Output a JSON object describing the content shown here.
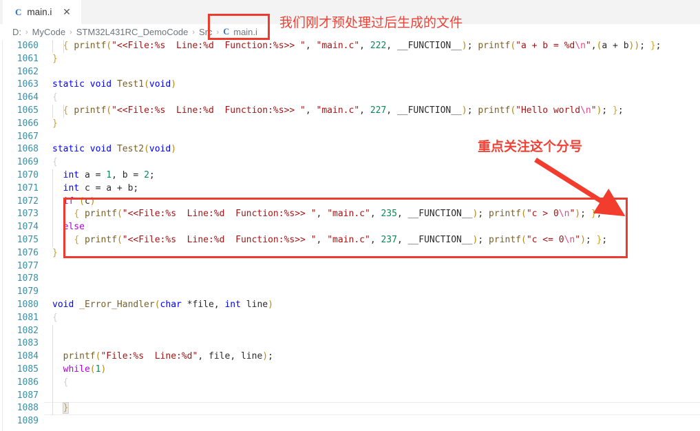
{
  "tab": {
    "file_icon": "C",
    "label": "main.i",
    "close_icon": "✕"
  },
  "breadcrumb": {
    "separator": "›",
    "items": [
      "D:",
      "MyCode",
      "STM32L431RC_DemoCode",
      "Src"
    ],
    "file_icon": "C",
    "file": "main.i"
  },
  "annotations": {
    "top_note": "我们刚才预处理过后生成的文件",
    "code_note": "重点关注这个分号",
    "color": "#ef3b2d"
  },
  "editor": {
    "first_line_number": 1060,
    "lines": [
      {
        "n": 1060,
        "indent": 2,
        "guides": [
          0,
          1
        ],
        "code": "  { printf(\"<<File:%s  Line:%d  Function:%s>> \", \"main.c\", 222, __FUNCTION__); printf(\"a + b = %d\\n\",(a + b)); };"
      },
      {
        "n": 1061,
        "indent": 0,
        "guides": [],
        "code": "}"
      },
      {
        "n": 1062,
        "indent": 0,
        "guides": [],
        "code": ""
      },
      {
        "n": 1063,
        "indent": 0,
        "guides": [],
        "code": "static void Test1(void)"
      },
      {
        "n": 1064,
        "indent": 0,
        "guides": [],
        "code": "{"
      },
      {
        "n": 1065,
        "indent": 2,
        "guides": [
          0,
          1
        ],
        "code": "  { printf(\"<<File:%s  Line:%d  Function:%s>> \", \"main.c\", 227, __FUNCTION__); printf(\"Hello world\\n\"); };"
      },
      {
        "n": 1066,
        "indent": 0,
        "guides": [],
        "code": "}"
      },
      {
        "n": 1067,
        "indent": 0,
        "guides": [],
        "code": ""
      },
      {
        "n": 1068,
        "indent": 0,
        "guides": [],
        "code": "static void Test2(void)"
      },
      {
        "n": 1069,
        "indent": 0,
        "guides": [],
        "code": "{"
      },
      {
        "n": 1070,
        "indent": 1,
        "guides": [
          0
        ],
        "code": "  int a = 1, b = 2;"
      },
      {
        "n": 1071,
        "indent": 1,
        "guides": [
          0
        ],
        "code": "  int c = a + b;"
      },
      {
        "n": 1072,
        "indent": 1,
        "guides": [
          0
        ],
        "code": "  if (c)"
      },
      {
        "n": 1073,
        "indent": 2,
        "guides": [
          0,
          1
        ],
        "code": "    { printf(\"<<File:%s  Line:%d  Function:%s>> \", \"main.c\", 235, __FUNCTION__); printf(\"c > 0\\n\"); };"
      },
      {
        "n": 1074,
        "indent": 1,
        "guides": [
          0
        ],
        "code": "  else"
      },
      {
        "n": 1075,
        "indent": 2,
        "guides": [
          0,
          1
        ],
        "code": "    { printf(\"<<File:%s  Line:%d  Function:%s>> \", \"main.c\", 237, __FUNCTION__); printf(\"c <= 0\\n\"); };"
      },
      {
        "n": 1076,
        "indent": 0,
        "guides": [],
        "code": "}"
      },
      {
        "n": 1077,
        "indent": 0,
        "guides": [],
        "code": ""
      },
      {
        "n": 1078,
        "indent": 0,
        "guides": [],
        "code": ""
      },
      {
        "n": 1079,
        "indent": 0,
        "guides": [],
        "code": ""
      },
      {
        "n": 1080,
        "indent": 0,
        "guides": [],
        "code": "void _Error_Handler(char *file, int line)"
      },
      {
        "n": 1081,
        "indent": 0,
        "guides": [],
        "code": "{"
      },
      {
        "n": 1082,
        "indent": 1,
        "guides": [
          0
        ],
        "code": ""
      },
      {
        "n": 1083,
        "indent": 1,
        "guides": [
          0
        ],
        "code": ""
      },
      {
        "n": 1084,
        "indent": 1,
        "guides": [
          0
        ],
        "code": "  printf(\"File:%s  Line:%d\", file, line);"
      },
      {
        "n": 1085,
        "indent": 1,
        "guides": [
          0
        ],
        "code": "  while(1)"
      },
      {
        "n": 1086,
        "indent": 1,
        "guides": [
          0
        ],
        "code": "  {"
      },
      {
        "n": 1087,
        "indent": 1,
        "guides": [
          0
        ],
        "code": ""
      },
      {
        "n": 1088,
        "indent": 1,
        "guides": [
          0
        ],
        "code": "  }"
      },
      {
        "n": 1089,
        "indent": 0,
        "guides": [],
        "code": ""
      }
    ],
    "highlighted_line": 1088
  }
}
